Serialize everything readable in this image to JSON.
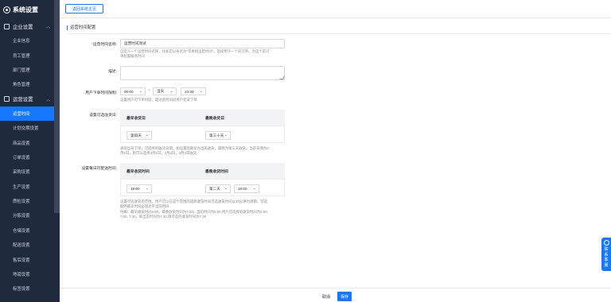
{
  "app": {
    "title": "系统设置"
  },
  "sidebar": {
    "groups": [
      {
        "label": "企业设置",
        "items": [
          "企业信息",
          "员工管理",
          "部门管理",
          "角色管理"
        ]
      },
      {
        "label": "运营设置",
        "items": [
          "运营时间",
          "计划交期设置",
          "商品设置",
          "订单设置",
          "采购设置",
          "生产设置",
          "质检设置",
          "分拣设置",
          "仓储设置",
          "配送设置",
          "售后设置",
          "地磅设置",
          "标签设置"
        ]
      }
    ],
    "active_item": "运营时间"
  },
  "header": {
    "back_button": "返回系统主页"
  },
  "section": {
    "title": "运营时间配置"
  },
  "form": {
    "name": {
      "label": "运营时间名称:",
      "value": "运营时间测试",
      "hint_line1": "自定义一个运营时间名称，比如可以命名为\"常青相运营时间\"，后续用于一个前订单。为这个前订",
      "hint_line2": "单配置服务时间"
    },
    "description": {
      "label": "描述:"
    },
    "order_limit": {
      "label": "用户下单时间限制:",
      "start": "00:00",
      "tilde": "~",
      "day": "当天",
      "end": "23:30",
      "hint": "设置用户可下单时段，超过此时间段用户无法下单"
    },
    "receive_date": {
      "label": "设置可选收货日:",
      "col1": "最早收货日",
      "col2": "最晚收货日",
      "val1": "第四天",
      "val2": "第三十天",
      "hint_line1": "表明当日下单，可选择的收货日期。如设置的最早为当天收货，最晚为第三天收货，当前日期为3",
      "hint_line2": "月1日，则可以选择3月1日，3月2日，3月3日收货"
    },
    "delivery_time": {
      "label": "设置每日可配送时间:",
      "col1": "最早收货时间",
      "col2": "最晚收货时间",
      "start": "19:00",
      "day": "第二天",
      "end": "19:00",
      "hint_line1": "设置可选收货的范围，用户可以在这个范围内选择收货时间可选收货时间以30分钟为周期，可选",
      "hint_line2": "配的最早时间必须大于当前时间",
      "hint_line3": "例如：最早收货时间6:00，最晚收货时间为7:30，当前时间为5:00,用户可选择的收货时间为6:00,",
      "hint_line4": "7:00, 7:30，如当前时间为7:30,则可选的收货时间为7:30"
    }
  },
  "footer": {
    "cancel": "取消",
    "save": "保存"
  },
  "service_tab": {
    "label": "联系客服"
  },
  "colors": {
    "primary": "#1677ff",
    "sidebar_bg": "#1f2a3d"
  }
}
